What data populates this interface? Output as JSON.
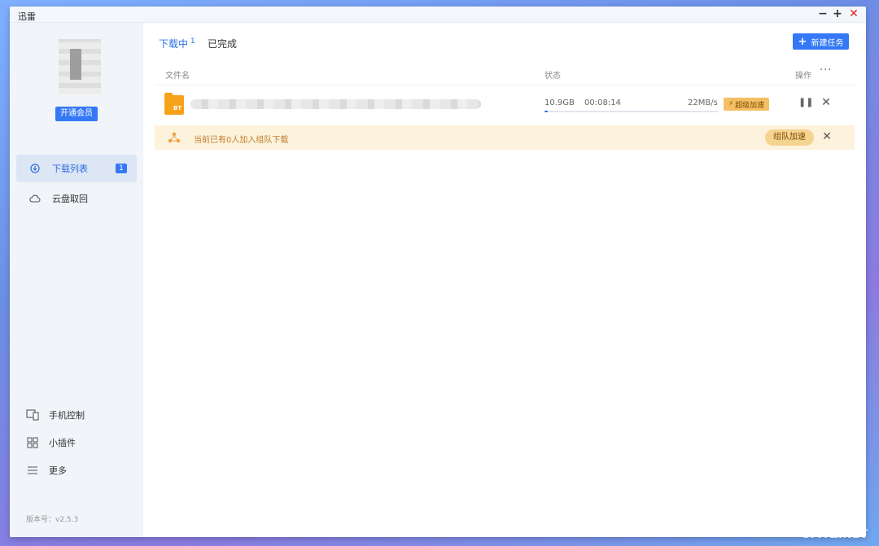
{
  "window": {
    "title": "迅雷"
  },
  "sidebar": {
    "vip_button": "开通会员",
    "nav": [
      {
        "label": "下载列表",
        "badge": "1"
      },
      {
        "label": "云盘取回"
      }
    ],
    "bottom": [
      {
        "label": "手机控制",
        "icon": "device-icon"
      },
      {
        "label": "小插件",
        "icon": "grid-icon"
      },
      {
        "label": "更多",
        "icon": "menu-icon"
      }
    ],
    "version": "版本号：v2.5.3"
  },
  "main": {
    "tabs": {
      "downloading": "下载中",
      "downloading_count": "1",
      "completed": "已完成"
    },
    "new_task_button": "新建任务",
    "columns": {
      "file": "文件名",
      "status": "状态",
      "ops": "操作",
      "more": "···"
    },
    "task": {
      "file_type": "BT",
      "size": "10.9GB",
      "remaining": "00:08:14",
      "speed": "22MB/s",
      "progress": 0.02,
      "boost_label": "超级加速"
    },
    "team_notice": {
      "text": "当前已有0人加入组队下载",
      "button": "组队加速"
    }
  },
  "watermark": {
    "line1": "值 什么值得买",
    "line2": "SMYZ.NET"
  },
  "colors": {
    "accent": "#3478f6",
    "warning_bg": "#fdf3dc",
    "boost": "#f5c064"
  }
}
